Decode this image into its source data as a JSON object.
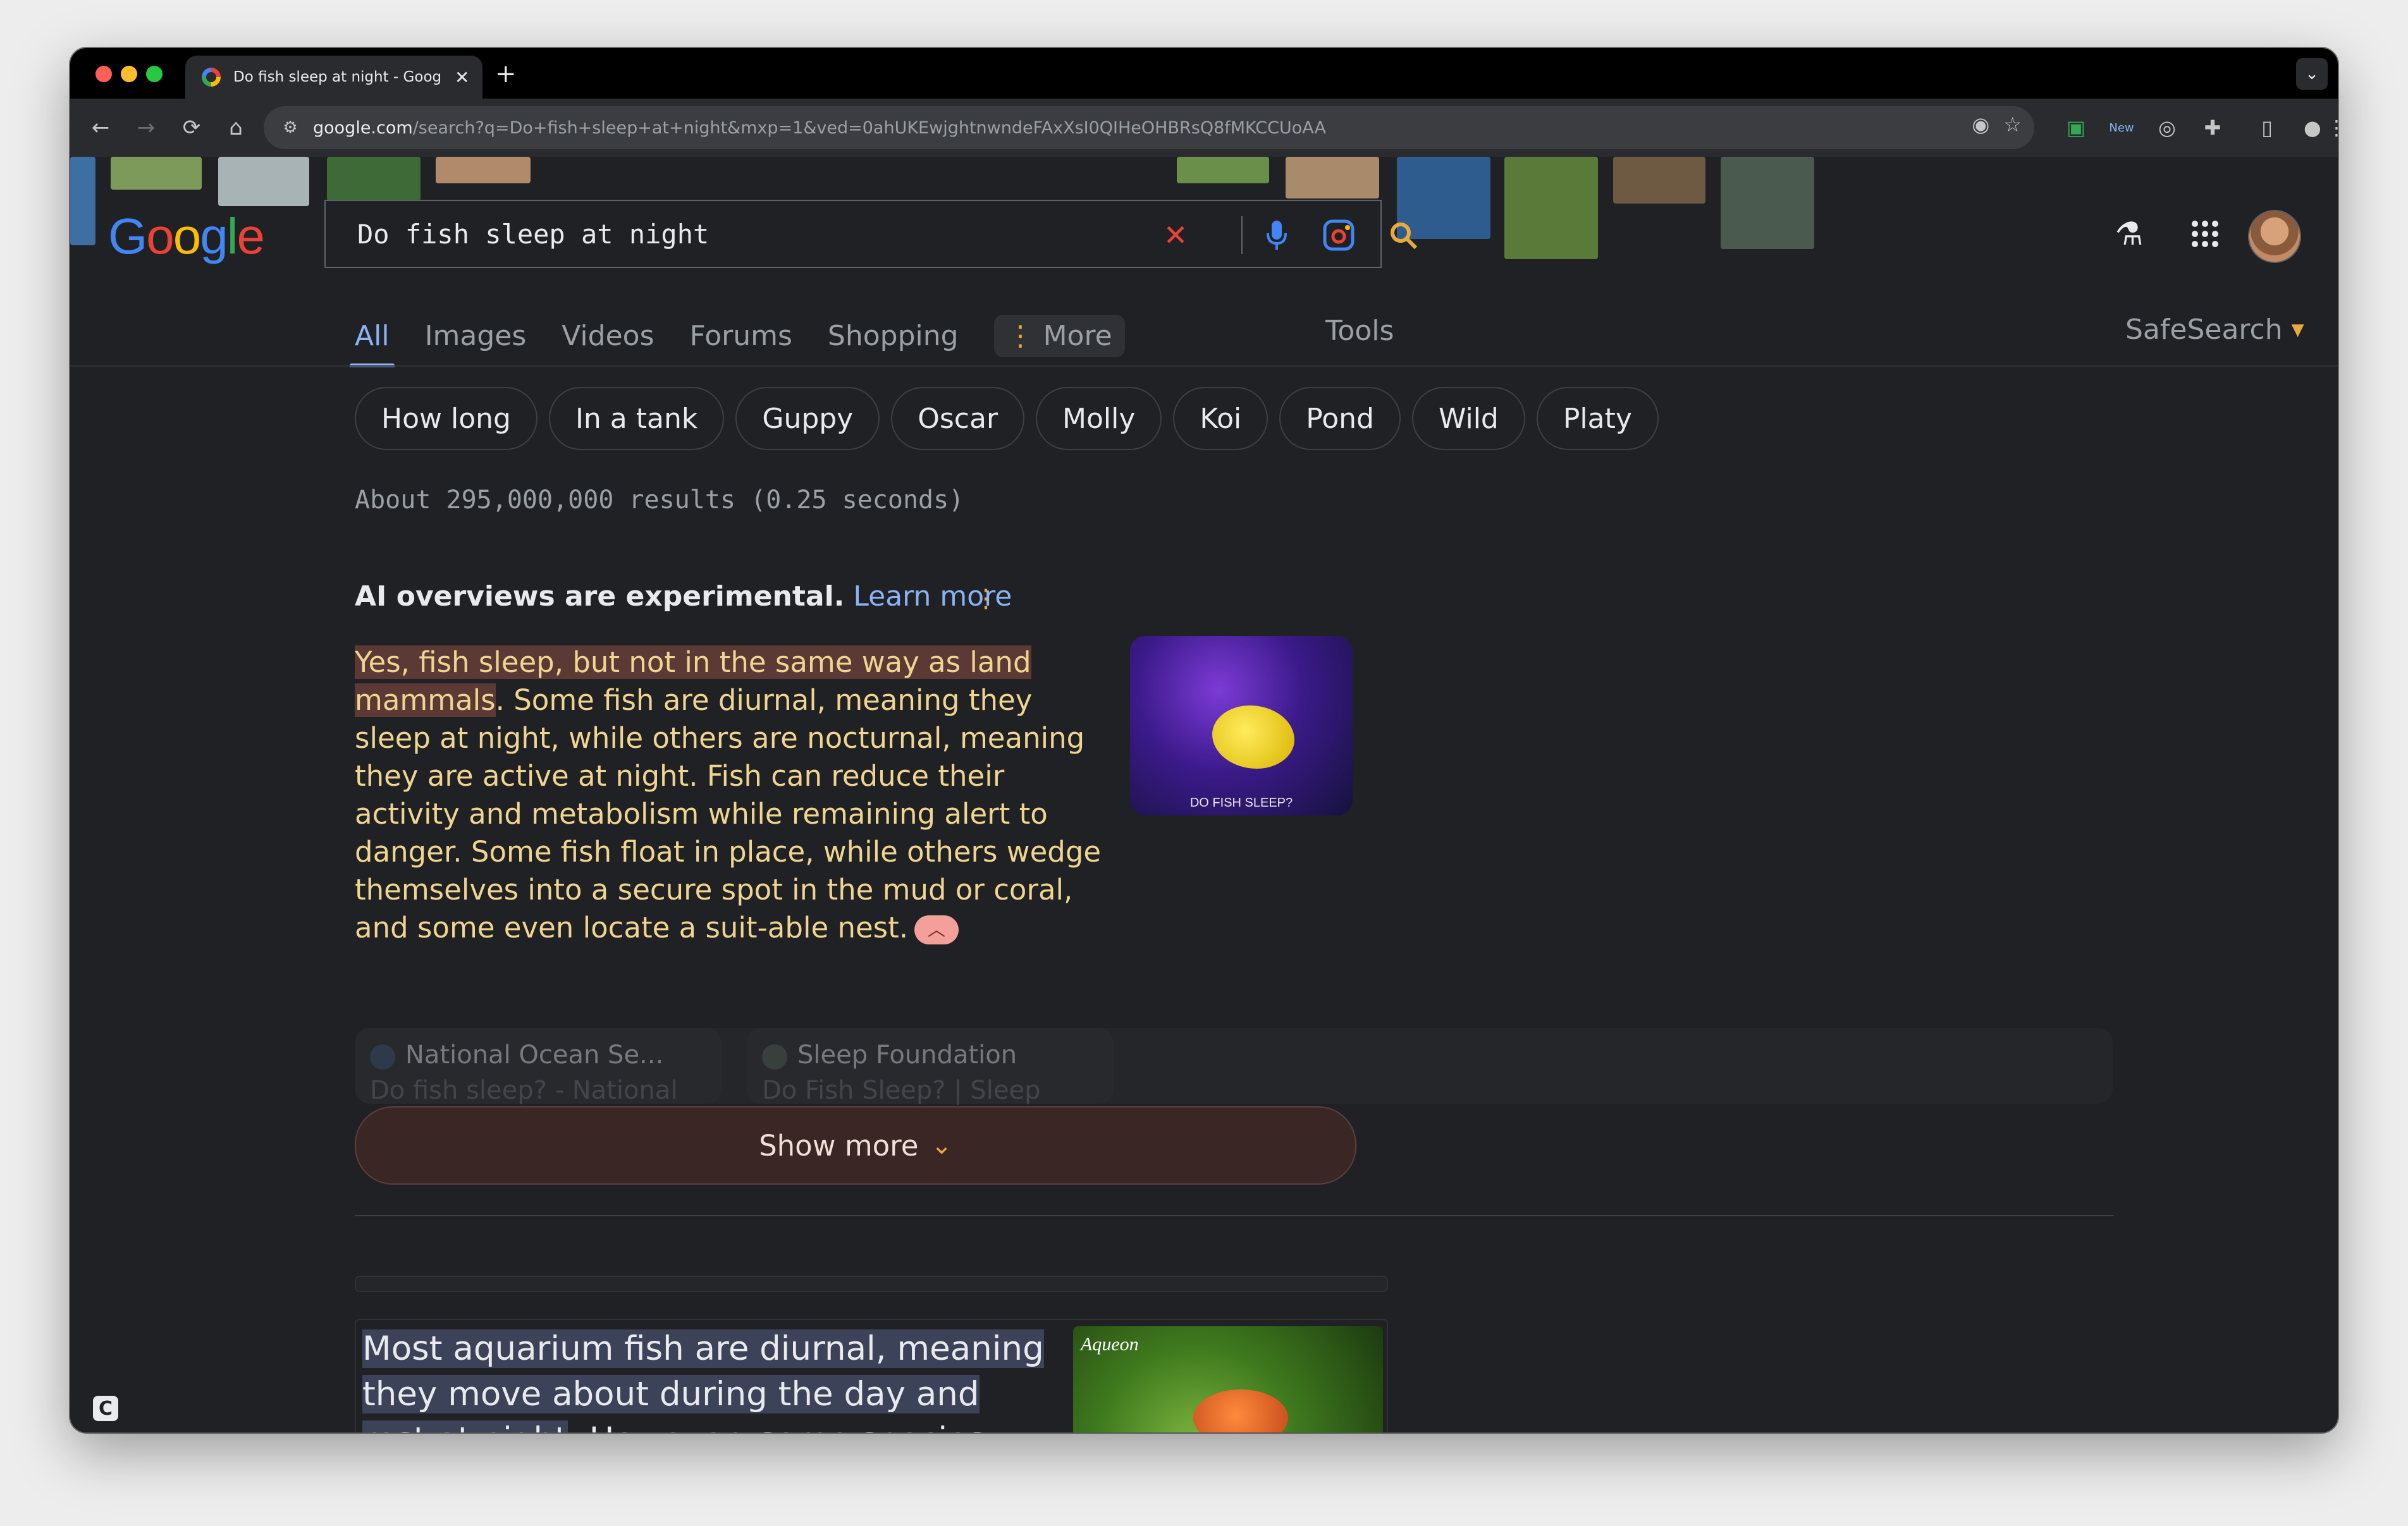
{
  "browser": {
    "tab_title": "Do fish sleep at night - Goog",
    "url_host": "google.com",
    "url_rest": "/search?q=Do+fish+sleep+at+night&mxp=1&ved=0ahUKEwjghtnwndeFAxXsI0QIHeOHBRsQ8fMKCCUoAA",
    "new_badge": "New"
  },
  "search": {
    "logo": "Google",
    "query": "Do fish sleep at night",
    "tabs": [
      "All",
      "Images",
      "Videos",
      "Forums",
      "Shopping"
    ],
    "more_label": "More",
    "tools_label": "Tools",
    "safesearch_label": "SafeSearch",
    "chips": [
      "How long",
      "In a tank",
      "Guppy",
      "Oscar",
      "Molly",
      "Koi",
      "Pond",
      "Wild",
      "Platy"
    ],
    "result_stats": "About 295,000,000 results (0.25 seconds)"
  },
  "ai_overview": {
    "notice": "AI overviews are experimental.",
    "learn_more": "Learn more",
    "highlight": "Yes, fish sleep, but not in the same way as land mammals",
    "body": ". Some fish are diurnal, meaning they sleep at night, while others are nocturnal, meaning they are active at night. Fish can reduce their activity and metabolism while remaining alert to danger. Some fish float in place, while others wedge themselves into a secure spot in the mud or coral, and some even locate a suit-able nest.",
    "image_caption": "DO FISH SLEEP?",
    "sources": [
      {
        "name": "National Ocean Se...",
        "sub": "Do fish sleep? - National"
      },
      {
        "name": "Sleep Foundation",
        "sub": "Do Fish Sleep? | Sleep"
      }
    ],
    "show_more": "Show more"
  },
  "snippet": {
    "highlight": "Most aquarium fish are diurnal, meaning they move about during the day and rest at night",
    "body": ". However, some species are nocturnal and prowl at night, spending",
    "image_brand": "Aqueon"
  },
  "colors": {
    "accent_blue": "#8ab4f8",
    "ai_text": "#f0d590",
    "highlight": "#5b3a36",
    "page_bg": "#202124"
  }
}
